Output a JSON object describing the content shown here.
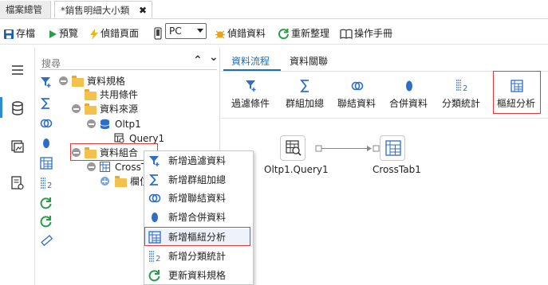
{
  "tabs": [
    {
      "label": "檔案總管"
    },
    {
      "label": "*銷售明細大小類",
      "close": "✖"
    }
  ],
  "toolbar": {
    "save": "存檔",
    "preview": "預覽",
    "detect_page": "偵錯頁面",
    "device_select": "PC",
    "detect_data": "偵錯資料",
    "reorganize": "重新整理",
    "manual": "操作手冊"
  },
  "tree": {
    "search_placeholder": "搜尋",
    "nodes": {
      "data_spec": "資料規格",
      "shared_conditions": "共用條件",
      "data_source": "資料來源",
      "oltp1": "Oltp1",
      "query1": "Query1",
      "data_combine": "資料組合",
      "crosstab": "CrossT",
      "pivot_child": "欄位"
    }
  },
  "context_menu": {
    "items": [
      {
        "label": "新增過濾資料",
        "icon": "filter-icon"
      },
      {
        "label": "新增群組加總",
        "icon": "sigma-icon"
      },
      {
        "label": "新增聯結資料",
        "icon": "join-icon"
      },
      {
        "label": "新增合併資料",
        "icon": "merge-icon"
      },
      {
        "label": "新增樞紐分析",
        "icon": "pivot-icon"
      },
      {
        "label": "新增分類統計",
        "icon": "category-stats-icon"
      },
      {
        "label": "更新資料規格",
        "icon": "refresh-icon"
      }
    ]
  },
  "right_pane": {
    "tabs": [
      "資料流程",
      "資料關聯"
    ],
    "buttons": [
      {
        "label": "過濾條件",
        "icon": "filter-icon"
      },
      {
        "label": "群組加總",
        "icon": "sigma-icon"
      },
      {
        "label": "聯結資料",
        "icon": "join-icon"
      },
      {
        "label": "合併資料",
        "icon": "merge-icon"
      },
      {
        "label": "分類統計",
        "icon": "category-stats-icon"
      },
      {
        "label": "樞紐分析",
        "icon": "pivot-icon"
      }
    ],
    "flow": {
      "source_label": "Oltp1.Query1",
      "target_label": "CrossTab1"
    }
  },
  "colors": {
    "accent": "#1a6fb5",
    "highlight_border": "#e03b3b",
    "green": "#2a9d4a"
  }
}
